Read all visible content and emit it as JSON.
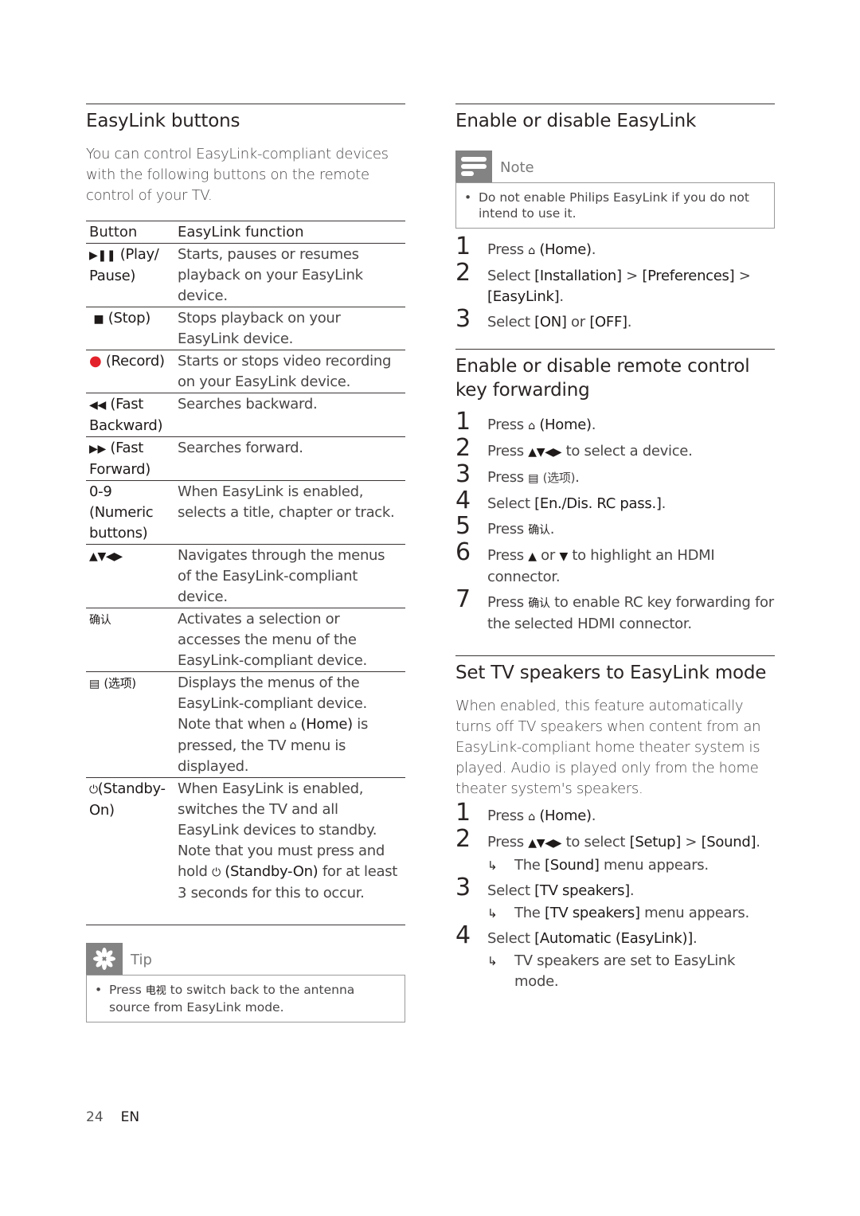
{
  "left": {
    "title": "EasyLink buttons",
    "intro": "You can control EasyLink-compliant devices with the following buttons on the remote control of your TV.",
    "table": {
      "headers": [
        "Button",
        "EasyLink function"
      ],
      "rows": [
        {
          "icon": "play-pause-icon",
          "symbol": "▶❚❚",
          "key": "(Play/ Pause)",
          "function": "Starts, pauses or resumes playback on your EasyLink device."
        },
        {
          "icon": "stop-icon",
          "symbol": "■",
          "key": "(Stop)",
          "function": "Stops playback on your EasyLink device."
        },
        {
          "icon": "record-icon",
          "symbol": "●",
          "key": "(Record)",
          "function": "Starts or stops video recording on your EasyLink device."
        },
        {
          "icon": "fast-backward-icon",
          "symbol": "◀◀",
          "key": "(Fast Backward)",
          "function": "Searches backward."
        },
        {
          "icon": "fast-forward-icon",
          "symbol": "▶▶",
          "key": "(Fast Forward)",
          "function": "Searches forward."
        },
        {
          "icon": "",
          "symbol": "",
          "key": "0-9 (Numeric buttons)",
          "function": "When EasyLink is enabled, selects a title, chapter or track."
        },
        {
          "icon": "navigation-arrows-icon",
          "symbol": "▲▼◀▶",
          "key": "",
          "function": "Navigates through the menus of the EasyLink-compliant device."
        },
        {
          "icon": "",
          "symbol": "",
          "key": "确认",
          "function": "Activates a selection or accesses the menu of the EasyLink-compliant device."
        },
        {
          "icon": "options-icon",
          "symbol": "▤",
          "key": "(选项)",
          "function_parts": [
            "Displays the menus of the EasyLink-compliant device. Note that when ",
            "(Home)",
            " is pressed, the TV menu is displayed."
          ]
        },
        {
          "icon": "power-icon",
          "symbol": "⏻",
          "key": "(Standby-On)",
          "function_parts": [
            "When EasyLink is enabled, switches the TV and all EasyLink devices to standby. Note that you must press and hold ",
            "(Standby-On)",
            " for at least 3 seconds for this to occur."
          ]
        }
      ]
    },
    "tip": {
      "label": "Tip",
      "text_before": "Press ",
      "key": "电视",
      "text_after": " to switch back to the antenna source from EasyLink mode."
    }
  },
  "right": {
    "enable": {
      "title": "Enable or disable EasyLink",
      "note": {
        "label": "Note",
        "text": "Do not enable Philips EasyLink if you do not intend to use it."
      },
      "steps": [
        {
          "num": "1",
          "parts": [
            "Press ",
            "(Home)",
            "."
          ]
        },
        {
          "num": "2",
          "parts": [
            "Select ",
            "[Installation]",
            " > ",
            "[Preferences]",
            " > ",
            "[EasyLink]",
            "."
          ]
        },
        {
          "num": "3",
          "parts": [
            "Select ",
            "[ON]",
            " or ",
            "[OFF]",
            "."
          ]
        }
      ]
    },
    "forwarding": {
      "title": "Enable or disable remote control key forwarding",
      "steps": [
        {
          "num": "1",
          "a": "Press ",
          "b": "(Home)",
          "c": "."
        },
        {
          "num": "2",
          "a": "Press ",
          "sym": "▲▼◀▶",
          "c": " to select a device."
        },
        {
          "num": "3",
          "a": "Press ",
          "b": "(选项)",
          "c": "."
        },
        {
          "num": "4",
          "a": "Select ",
          "b": "[En./Dis. RC pass.]",
          "c": "."
        },
        {
          "num": "5",
          "a": "Press ",
          "b": "确认",
          "c": "."
        },
        {
          "num": "6",
          "a": "Press ",
          "up": "▲",
          "mid": " or ",
          "down": "▼",
          "c": " to highlight an HDMI connector."
        },
        {
          "num": "7",
          "a": "Press ",
          "b": "确认",
          "c": " to enable RC key forwarding for the selected HDMI connector."
        }
      ]
    },
    "speakers": {
      "title": "Set TV speakers to EasyLink mode",
      "intro": "When enabled, this feature automatically turns off TV speakers when content from an EasyLink-compliant home theater system is played. Audio is played only from the home theater system's speakers.",
      "steps": [
        {
          "num": "1",
          "a": "Press ",
          "b": "(Home)",
          "c": "."
        },
        {
          "num": "2",
          "a": "Press ",
          "sym": "▲▼◀▶",
          "m": " to select ",
          "b": "[Setup]",
          "g": " > ",
          "b2": "[Sound]",
          "c": ".",
          "result": {
            "a": "The ",
            "b": "[Sound]",
            "c": " menu appears."
          }
        },
        {
          "num": "3",
          "a": "Select ",
          "b": "[TV speakers]",
          "c": ".",
          "result": {
            "a": "The ",
            "b": "[TV speakers]",
            "c": " menu appears."
          }
        },
        {
          "num": "4",
          "a": "Select ",
          "b": "[Automatic (EasyLink)]",
          "c": ".",
          "result": {
            "a": "TV speakers are set to EasyLink mode."
          }
        }
      ]
    }
  },
  "footer": {
    "page": "24",
    "lang": "EN"
  },
  "colors": {
    "record": "#e3212a",
    "box_header": "#838383",
    "text": "#4a4646",
    "rule": "#3a3434"
  }
}
